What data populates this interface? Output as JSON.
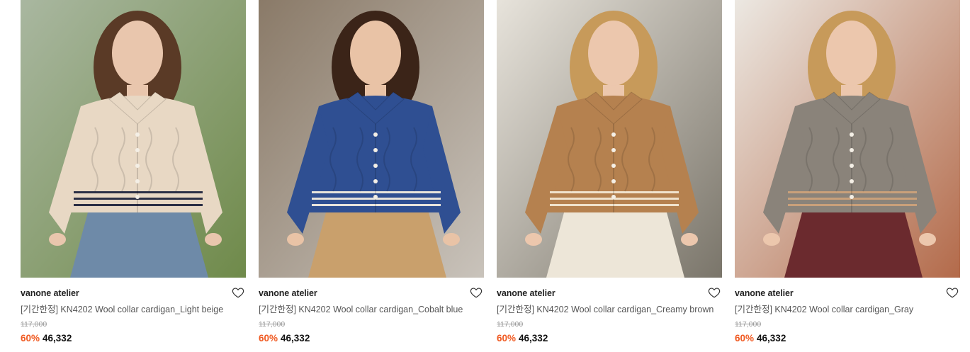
{
  "products": [
    {
      "brand": "vanone atelier",
      "title": "[기간한정] KN4202 Wool collar cardigan_Light beige",
      "original_price": "117,000",
      "discount": "60%",
      "sale_price": "46,332",
      "colors": {
        "bg": "#6f8a4a",
        "bg2": "#a9b7a0",
        "garment": "#e8d8c4",
        "stripe": "#2b2f45",
        "skin": "#e9c6ad",
        "hair": "#5a3a26",
        "pants": "#6e8aa8"
      }
    },
    {
      "brand": "vanone atelier",
      "title": "[기간한정] KN4202 Wool collar cardigan_Cobalt blue",
      "original_price": "117,000",
      "discount": "60%",
      "sale_price": "46,332",
      "colors": {
        "bg": "#c9c3bb",
        "bg2": "#8a7a68",
        "garment": "#2f4f92",
        "stripe": "#e8e4dc",
        "skin": "#e9c3a6",
        "hair": "#3b2418",
        "pants": "#c9a06c"
      }
    },
    {
      "brand": "vanone atelier",
      "title": "[기간한정] KN4202 Wool collar cardigan_Creamy brown",
      "original_price": "117,000",
      "discount": "60%",
      "sale_price": "46,332",
      "colors": {
        "bg": "#7a756a",
        "bg2": "#e7e3db",
        "garment": "#b5814f",
        "stripe": "#f0e2cc",
        "skin": "#ecc7ad",
        "hair": "#c79a5a",
        "pants": "#ede6d8"
      }
    },
    {
      "brand": "vanone atelier",
      "title": "[기간한정] KN4202 Wool collar cardigan_Gray",
      "original_price": "117,000",
      "discount": "60%",
      "sale_price": "46,332",
      "colors": {
        "bg": "#b36a4a",
        "bg2": "#ece8e2",
        "garment": "#8a837a",
        "stripe": "#c9a07a",
        "skin": "#ecc7ad",
        "hair": "#c79a5a",
        "pants": "#6b2a2e"
      }
    }
  ]
}
